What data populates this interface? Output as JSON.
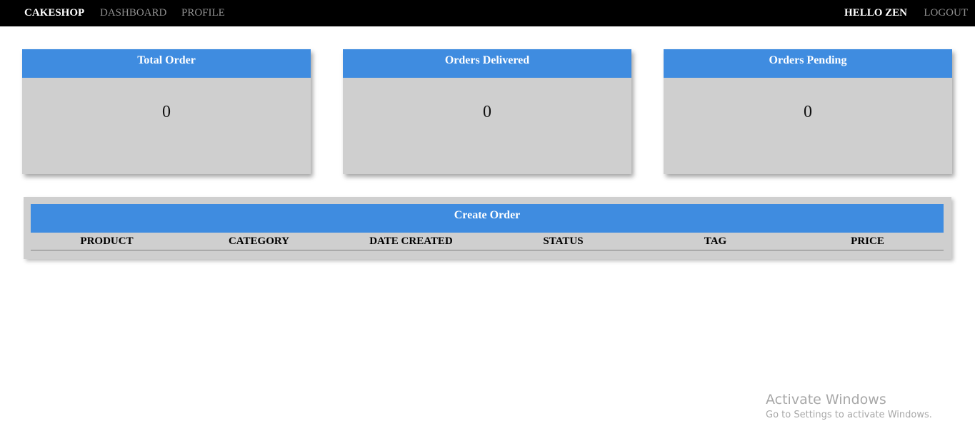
{
  "navbar": {
    "brand": "CAKESHOP",
    "links": [
      "DASHBOARD",
      "PROFILE"
    ],
    "greeting": "HELLO ZEN",
    "logout": "LOGOUT"
  },
  "stats": [
    {
      "title": "Total Order",
      "value": "0"
    },
    {
      "title": "Orders Delivered",
      "value": "0"
    },
    {
      "title": "Orders Pending",
      "value": "0"
    }
  ],
  "orders": {
    "header": "Create Order",
    "columns": [
      "PRODUCT",
      "CATEGORY",
      "DATE CREATED",
      "STATUS",
      "TAG",
      "PRICE"
    ],
    "rows": []
  },
  "watermark": {
    "title": "Activate Windows",
    "subtitle": "Go to Settings to activate Windows."
  },
  "colors": {
    "navbar_bg": "#000000",
    "accent_blue": "#3f8ce0",
    "card_bg": "#cfcfcf"
  }
}
